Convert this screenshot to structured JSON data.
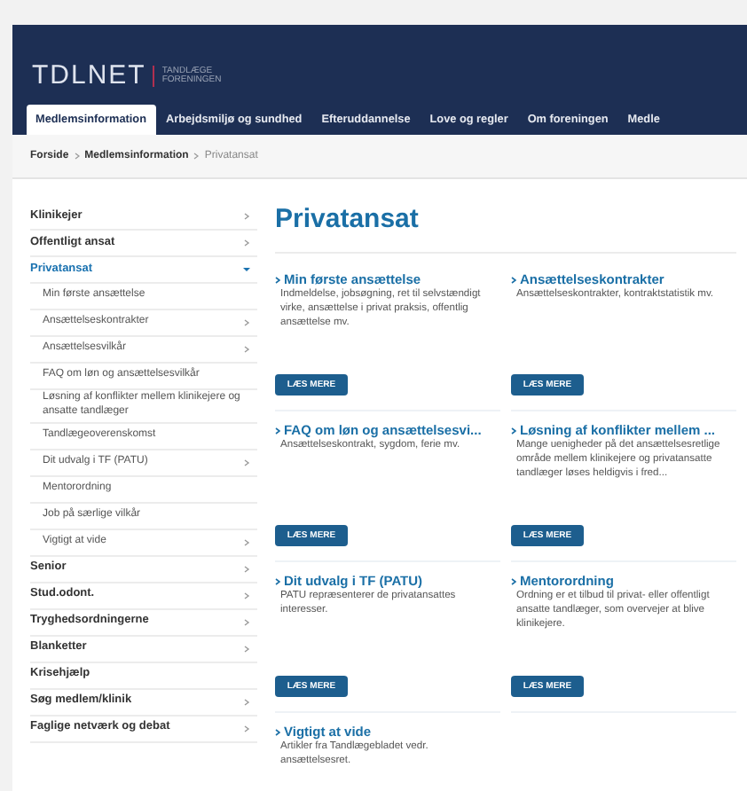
{
  "logo": {
    "name": "TDLNET",
    "tagline_1": "TANDLÆGE",
    "tagline_2": "FORENINGEN"
  },
  "nav": [
    {
      "label": "Medlemsinformation",
      "selected": true
    },
    {
      "label": "Arbejdsmiljø og sundhed",
      "selected": false
    },
    {
      "label": "Efteruddannelse",
      "selected": false
    },
    {
      "label": "Love og regler",
      "selected": false
    },
    {
      "label": "Om foreningen",
      "selected": false
    },
    {
      "label": "Medle",
      "selected": false
    }
  ],
  "breadcrumb": [
    {
      "label": "Forside",
      "current": false
    },
    {
      "label": "Medlemsinformation",
      "current": false
    },
    {
      "label": "Privatansat",
      "current": true
    }
  ],
  "sidebar": [
    {
      "label": "Klinikejer",
      "arrow": true,
      "selected": false
    },
    {
      "label": "Offentligt ansat",
      "arrow": true,
      "selected": false
    },
    {
      "label": "Privatansat",
      "arrow": true,
      "selected": true,
      "expanded": true,
      "children": [
        {
          "label": "Min første ansættelse",
          "arrow": false
        },
        {
          "label": "Ansættelseskontrakter",
          "arrow": true
        },
        {
          "label": "Ansættelsesvilkår",
          "arrow": true
        },
        {
          "label": "FAQ om løn og ansættelsesvilkår",
          "arrow": false
        },
        {
          "label": "Løsning af konflikter mellem klinikejere og ansatte tandlæger",
          "arrow": false
        },
        {
          "label": "Tandlægeoverenskomst",
          "arrow": false
        },
        {
          "label": "Dit udvalg i TF (PATU)",
          "arrow": true
        },
        {
          "label": "Mentorordning",
          "arrow": false
        },
        {
          "label": "Job på særlige vilkår",
          "arrow": false
        },
        {
          "label": "Vigtigt at vide",
          "arrow": true
        }
      ]
    },
    {
      "label": "Senior",
      "arrow": true,
      "selected": false
    },
    {
      "label": "Stud.odont.",
      "arrow": true,
      "selected": false
    },
    {
      "label": "Tryghedsordningerne",
      "arrow": true,
      "selected": false
    },
    {
      "label": "Blanketter",
      "arrow": true,
      "selected": false
    },
    {
      "label": "Krisehjælp",
      "arrow": false,
      "selected": false
    },
    {
      "label": "Søg medlem/klinik",
      "arrow": true,
      "selected": false
    },
    {
      "label": "Faglige netværk og debat",
      "arrow": true,
      "selected": false
    }
  ],
  "page_title": "Privatansat",
  "cards": [
    {
      "title": "Min første ansættelse",
      "text": "Indmeldelse, jobsøgning, ret til selvstændigt virke, ansættelse i privat praksis, offentlig ansættelse mv.",
      "button": "LÆS MERE"
    },
    {
      "title": "Ansættelseskontrakter",
      "text": "Ansættelseskontrakter, kontraktstatistik mv.",
      "button": "LÆS MERE"
    },
    {
      "title": "FAQ om løn og ansættelsesvi...",
      "text": "Ansættelseskontrakt, sygdom, ferie mv.",
      "button": "LÆS MERE"
    },
    {
      "title": "Løsning af konflikter mellem ...",
      "text": "Mange uenigheder på det ansættelsesretlige område mellem klinikejere og privatansatte tandlæger løses heldigvis i fred...",
      "button": "LÆS MERE"
    },
    {
      "title": "Dit udvalg i TF (PATU)",
      "text": "PATU repræsenterer de privatansattes interesser.",
      "button": "LÆS MERE"
    },
    {
      "title": "Mentorordning",
      "text": "Ordning er et tilbud til privat- eller offentligt ansatte tandlæger, som overvejer at blive klinikejere.",
      "button": "LÆS MERE"
    },
    {
      "title": "Vigtigt at vide",
      "text": "Artikler fra Tandlægebladet vedr. ansættelsesret."
    }
  ]
}
